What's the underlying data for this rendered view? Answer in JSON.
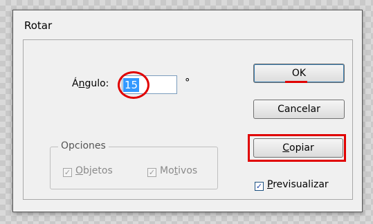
{
  "dialog": {
    "title": "Rotar",
    "angle": {
      "label_access": "Á",
      "label_key": "n",
      "label_rest": "gulo:",
      "value": "15",
      "unit": "°"
    },
    "options": {
      "legend": "Opciones",
      "objects": {
        "access": "O",
        "rest": "bjetos",
        "checked": true,
        "enabled": false
      },
      "patterns": {
        "pre": "Mo",
        "access": "t",
        "rest": "ivos",
        "checked": true,
        "enabled": false
      }
    },
    "buttons": {
      "ok": "OK",
      "cancel": "Cancelar",
      "copy_access": "C",
      "copy_rest": "opiar"
    },
    "preview": {
      "access": "P",
      "rest": "revisualizar",
      "checked": true
    }
  },
  "colors": {
    "highlight": "#e00000",
    "selection": "#3399ff"
  }
}
